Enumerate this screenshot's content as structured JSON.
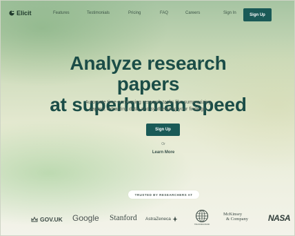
{
  "nav": {
    "logo_text": "Elicit",
    "links": [
      "Features",
      "Testimonials",
      "Pricing",
      "FAQ",
      "Careers"
    ],
    "sign_in": "Sign In",
    "sign_up": "Sign Up"
  },
  "hero": {
    "title_line1": "Analyze research papers",
    "title_line2": "at superhuman speed",
    "subtitle_line1": "Automate time-consuming research tasks like summarizing",
    "subtitle_line2": "papers, extracting data, and synthesizing your findings.",
    "cta_label": "Sign Up",
    "or_text": "Or",
    "learn_more": "Learn More"
  },
  "trusted": {
    "label": "TRUSTED BY RESEARCHERS AT",
    "logos": {
      "govuk": "GOV.UK",
      "google": "Google",
      "stanford": "Stanford",
      "astrazeneca": "AstraZeneca",
      "worldbank": "THE WORLD BANK",
      "mckinsey_line1": "McKinsey",
      "mckinsey_line2": "& Company",
      "nasa": "NASA"
    }
  },
  "colors": {
    "brand_dark_teal": "#1a5a57",
    "title_teal": "#1b4d47"
  },
  "icons": {
    "logo": "elicit-logo-icon",
    "govuk": "crown-icon",
    "astrazeneca": "astrazeneca-symbol-icon",
    "worldbank": "globe-icon"
  }
}
